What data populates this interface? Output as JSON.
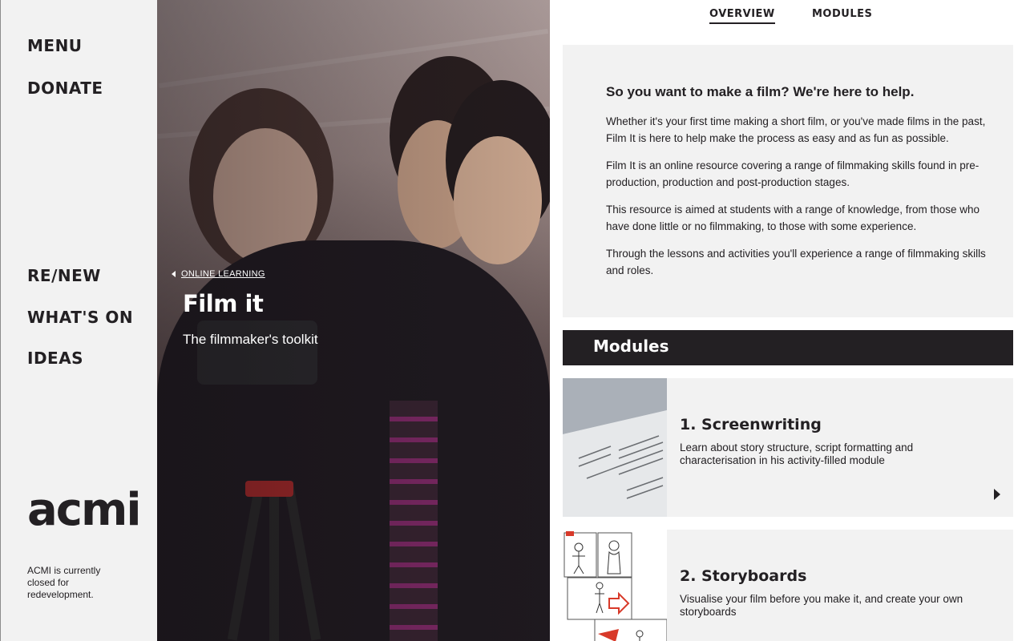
{
  "sidebar": {
    "menu_label": "MENU",
    "donate_label": "DONATE",
    "nav": [
      "RE/NEW",
      "WHAT'S ON",
      "IDEAS"
    ],
    "logo_text": "acmi",
    "closed_note": "ACMI is currently closed for redevelopment."
  },
  "hero": {
    "breadcrumb": "ONLINE LEARNING",
    "title": "Film it",
    "subtitle": "The filmmaker's toolkit"
  },
  "tabs": [
    {
      "label": "OVERVIEW",
      "active": true
    },
    {
      "label": "MODULES",
      "active": false
    }
  ],
  "overview": {
    "heading": "So you want to make a film? We're here to help.",
    "paragraphs": [
      "Whether it's your first time making a short film, or you've made films in the past, Film It is here to help make the process as easy and as fun as possible.",
      "Film It is an online resource covering a range of filmmaking skills found in pre-production, production and post-production stages.",
      "This resource is aimed at students with a range of knowledge, from those who have done little or no filmmaking, to those with some experience.",
      "Through the lessons and activities you'll experience a range of filmmaking skills and roles."
    ]
  },
  "modules": {
    "header": "Modules",
    "items": [
      {
        "title": "1. Screenwriting",
        "description": "Learn about story structure, script formatting and characterisation in his activity-filled module"
      },
      {
        "title": "2. Storyboards",
        "description": "Visualise your film before you make it, and create your own storyboards"
      }
    ]
  },
  "colors": {
    "dark": "#232023",
    "panel": "#f2f2f2",
    "sidebar": "#f2f2f2"
  },
  "icons": {
    "breadcrumb": "chevron-left-icon",
    "module_arrow": "triangle-right-icon"
  }
}
